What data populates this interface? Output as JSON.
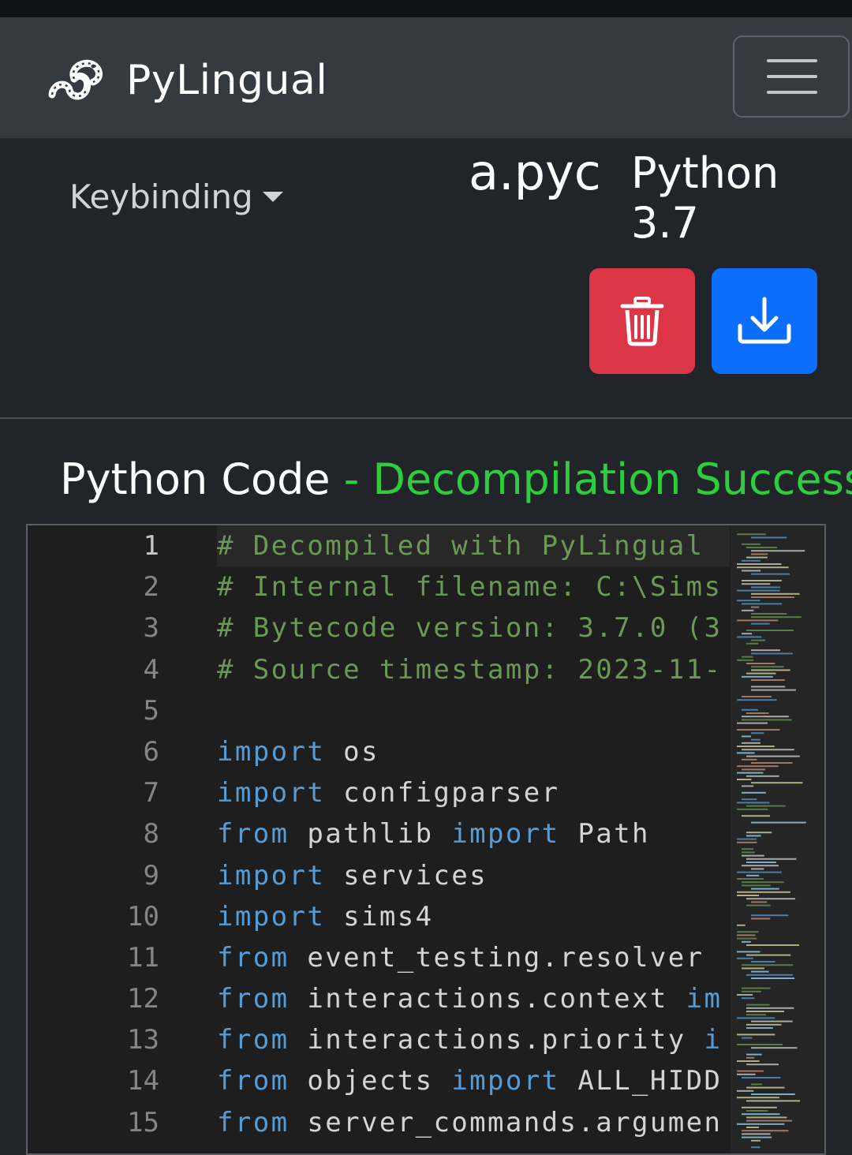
{
  "navbar": {
    "brand": "PyLingual",
    "logo_icon": "snake-icon",
    "menu_icon": "hamburger-menu-icon"
  },
  "toolbar": {
    "keybinding_label": "Keybinding",
    "filename": "a.pyc",
    "python_version": "Python 3.7",
    "delete_icon": "trash-icon",
    "download_icon": "download-icon"
  },
  "section": {
    "title": "Python Code",
    "status": " - Decompilation Success"
  },
  "colors": {
    "delete": "#dc3545",
    "download": "#0d6efd",
    "success": "#2fcc3e",
    "keyword": "#569cd6",
    "comment": "#6a9955"
  },
  "editor": {
    "line_numbers": [
      "1",
      "2",
      "3",
      "4",
      "5",
      "6",
      "7",
      "8",
      "9",
      "10",
      "11",
      "12",
      "13",
      "14",
      "15"
    ],
    "lines": [
      [
        {
          "t": "# Decompiled with PyLingual",
          "c": "cm"
        }
      ],
      [
        {
          "t": "# Internal filename: C:\\Sims",
          "c": "cm"
        }
      ],
      [
        {
          "t": "# Bytecode version: 3.7.0 (3",
          "c": "cm"
        }
      ],
      [
        {
          "t": "# Source timestamp: 2023-11-",
          "c": "cm"
        }
      ],
      [],
      [
        {
          "t": "import",
          "c": "kw"
        },
        {
          "t": " os",
          "c": ""
        }
      ],
      [
        {
          "t": "import",
          "c": "kw"
        },
        {
          "t": " configparser",
          "c": ""
        }
      ],
      [
        {
          "t": "from",
          "c": "kw"
        },
        {
          "t": " pathlib ",
          "c": ""
        },
        {
          "t": "import",
          "c": "kw"
        },
        {
          "t": " Path",
          "c": ""
        }
      ],
      [
        {
          "t": "import",
          "c": "kw"
        },
        {
          "t": " services",
          "c": ""
        }
      ],
      [
        {
          "t": "import",
          "c": "kw"
        },
        {
          "t": " sims4",
          "c": ""
        }
      ],
      [
        {
          "t": "from",
          "c": "kw"
        },
        {
          "t": " event_testing.resolver ",
          "c": ""
        }
      ],
      [
        {
          "t": "from",
          "c": "kw"
        },
        {
          "t": " interactions.context ",
          "c": ""
        },
        {
          "t": "im",
          "c": "kw"
        }
      ],
      [
        {
          "t": "from",
          "c": "kw"
        },
        {
          "t": " interactions.priority ",
          "c": ""
        },
        {
          "t": "i",
          "c": "kw"
        }
      ],
      [
        {
          "t": "from",
          "c": "kw"
        },
        {
          "t": " objects ",
          "c": ""
        },
        {
          "t": "import",
          "c": "kw"
        },
        {
          "t": " ALL_HIDD",
          "c": ""
        }
      ],
      [
        {
          "t": "from",
          "c": "kw"
        },
        {
          "t": " server_commands.argumen",
          "c": ""
        }
      ]
    ]
  }
}
